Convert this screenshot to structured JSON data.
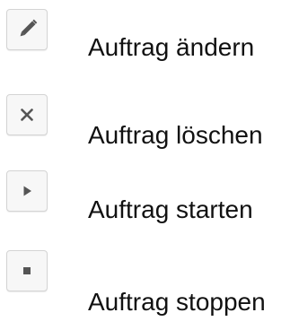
{
  "actions": [
    {
      "icon": "pencil-icon",
      "label": "Auftrag ändern"
    },
    {
      "icon": "close-icon",
      "label": "Auftrag löschen"
    },
    {
      "icon": "play-icon",
      "label": "Auftrag starten"
    },
    {
      "icon": "stop-icon",
      "label": "Auftrag stoppen"
    }
  ],
  "colors": {
    "icon": "#555555",
    "button_background": "#f7f7f7",
    "button_border": "#d4d4d4",
    "text": "#111111"
  }
}
